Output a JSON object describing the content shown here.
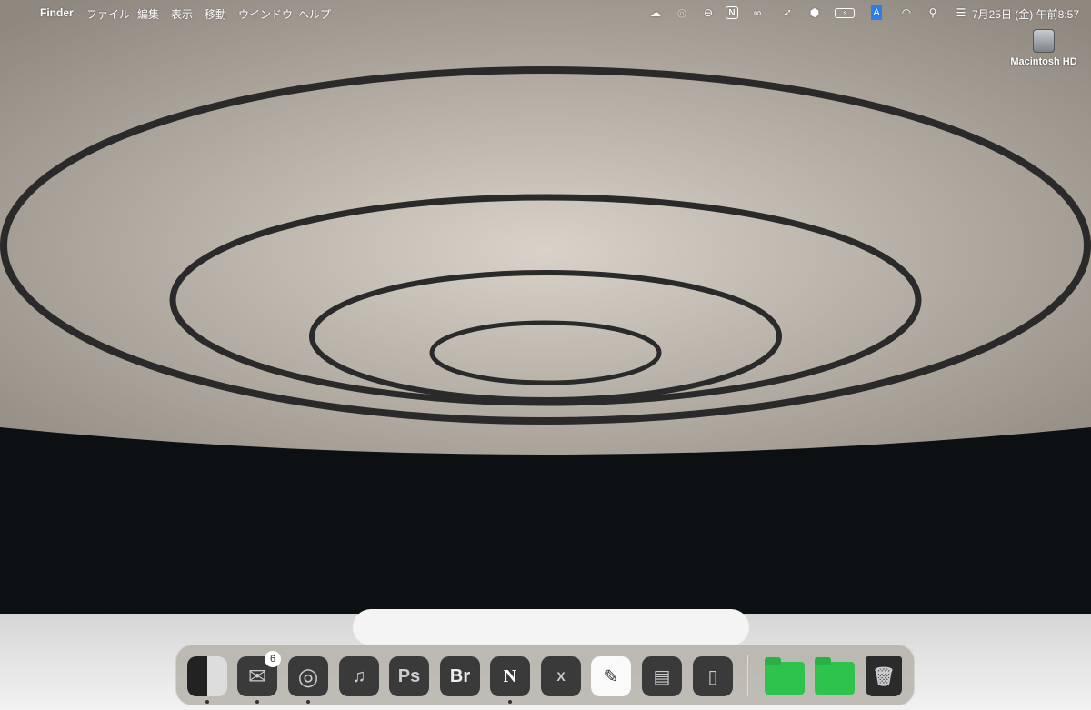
{
  "menubar": {
    "app_name": "Finder",
    "menus": [
      "ファイル",
      "編集",
      "表示",
      "移動",
      "ウインドウ",
      "ヘルプ"
    ],
    "status_icons": [
      "creative-cloud-sync-icon",
      "adobe-cc-icon",
      "toggle-icon",
      "notion-icon",
      "meta-icon",
      "cursor-icon",
      "deepl-icon",
      "battery-icon",
      "input-method-icon",
      "wifi-icon",
      "search-icon",
      "control-center-icon"
    ],
    "input_method": "A",
    "clock": "7月25日 (金) 午前8:57"
  },
  "desktop": {
    "drive_label": "Macintosh HD"
  },
  "dock": {
    "apps": [
      {
        "name": "finder",
        "label": "",
        "running": true
      },
      {
        "name": "mail",
        "label": "",
        "badge": "6",
        "running": true
      },
      {
        "name": "chrome",
        "label": "",
        "running": true
      },
      {
        "name": "music",
        "label": "♫",
        "running": false
      },
      {
        "name": "photoshop",
        "label": "Ps",
        "running": false
      },
      {
        "name": "bridge",
        "label": "Br",
        "running": false
      },
      {
        "name": "notion",
        "label": "N",
        "running": true
      },
      {
        "name": "excel",
        "label": "X",
        "running": false
      },
      {
        "name": "freeform",
        "label": "",
        "running": false
      },
      {
        "name": "preview",
        "label": "",
        "running": false
      },
      {
        "name": "remote",
        "label": "",
        "running": false
      }
    ]
  }
}
